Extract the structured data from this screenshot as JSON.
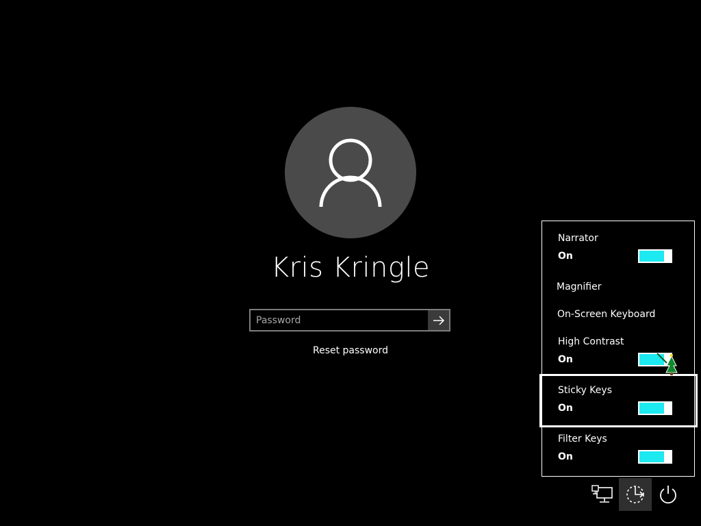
{
  "user": {
    "name": "Kris Kringle"
  },
  "password": {
    "placeholder": "Password"
  },
  "reset_link": "Reset password",
  "ease_of_access": {
    "items": [
      {
        "label": "Narrator",
        "state": "On",
        "toggle_on": true
      },
      {
        "label": "Magnifier"
      },
      {
        "label": "On-Screen Keyboard"
      },
      {
        "label": "High Contrast",
        "state": "On",
        "toggle_on": true
      },
      {
        "label": "Sticky Keys",
        "state": "On",
        "toggle_on": true,
        "focused": true
      },
      {
        "label": "Filter Keys",
        "state": "On",
        "toggle_on": true
      }
    ]
  },
  "tray": {
    "buttons": [
      {
        "icon": "network-icon"
      },
      {
        "icon": "ease-of-access-icon",
        "active": true
      },
      {
        "icon": "power-icon"
      }
    ]
  },
  "colors": {
    "background": "#000000",
    "avatar": "#4a4a4a",
    "toggle_accent": "#1de9f0"
  }
}
